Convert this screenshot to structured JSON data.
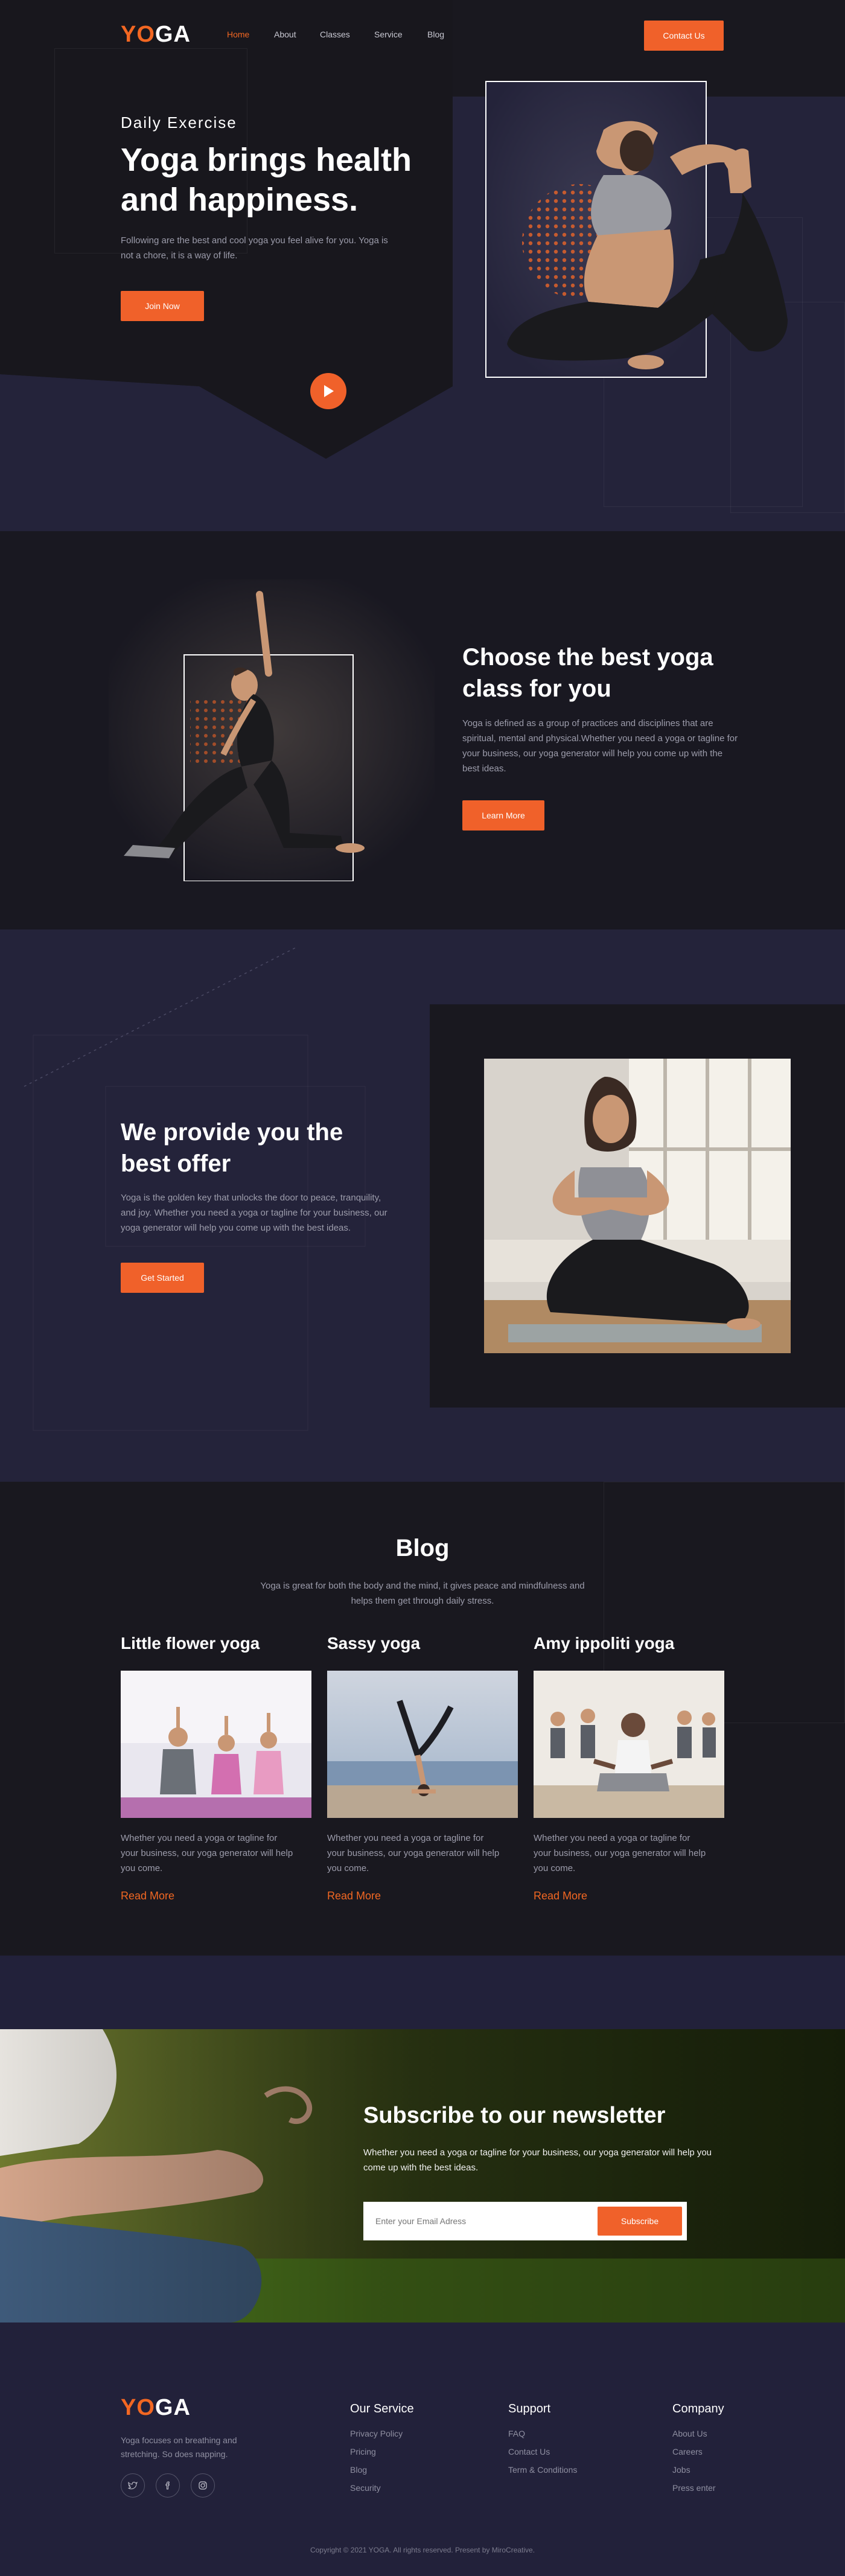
{
  "brand": {
    "logo_yo": "YO",
    "logo_ga": "GA",
    "accent": "#f26722",
    "dark_bg": "#19181f",
    "navy_bg": "#24233a"
  },
  "nav": {
    "items": [
      "Home",
      "About",
      "Classes",
      "Service",
      "Blog"
    ],
    "contact_button": "Contact Us"
  },
  "hero": {
    "kicker": "Daily Exercise",
    "title": "Yoga brings health and happiness.",
    "description": "Following are the best and cool yoga you feel alive for you. Yoga is not a chore, it is a way of life.",
    "cta": "Join Now",
    "play_icon": "play-icon"
  },
  "classes": {
    "title": "Choose the best yoga class for you",
    "description": "Yoga is defined as a group of practices and disciplines that are spiritual, mental and physical.Whether you need a yoga or tagline for your business, our yoga generator will help you come up with the best ideas.",
    "cta": "Learn More"
  },
  "offer": {
    "title": "We provide you the best offer",
    "description": "Yoga is the golden key that unlocks the door to peace, tranquility, and joy. Whether you need a yoga or tagline for your business, our yoga generator will help you come up with the best ideas.",
    "cta": "Get Started"
  },
  "blog": {
    "title": "Blog",
    "subtitle": "Yoga is great for both the body and the mind, it gives peace and mindfulness and helps them get through daily stress.",
    "cards": [
      {
        "title": "Little flower yoga",
        "description": "Whether you need a yoga or tagline for your business, our yoga generator will help you come.",
        "link": "Read More"
      },
      {
        "title": "Sassy yoga",
        "description": "Whether you need a yoga or tagline for your business, our yoga generator will help you come.",
        "link": "Read More"
      },
      {
        "title": "Amy ippoliti yoga",
        "description": "Whether you need a yoga or tagline for your business, our yoga generator will help you come.",
        "link": "Read More"
      }
    ]
  },
  "newsletter": {
    "title": "Subscribe to our newsletter",
    "description": "Whether you need a yoga or tagline for your business, our yoga generator will help you come up with the best ideas.",
    "placeholder": "Enter your Email Adress",
    "button": "Subscribe"
  },
  "footer": {
    "tagline": "Yoga focuses on breathing and stretching. So does napping.",
    "social_icons": [
      "twitter-icon",
      "facebook-icon",
      "instagram-icon"
    ],
    "columns": [
      {
        "heading": "Our Service",
        "links": [
          "Privacy Policy",
          "Pricing",
          "Blog",
          "Security"
        ]
      },
      {
        "heading": "Support",
        "links": [
          "FAQ",
          "Contact Us",
          "Term & Conditions"
        ]
      },
      {
        "heading": "Company",
        "links": [
          "About Us",
          "Careers",
          "Jobs",
          "Press enter"
        ]
      }
    ],
    "copyright": "Copyright © 2021 YOGA. All rights reserved. Present by MiroCreative."
  }
}
